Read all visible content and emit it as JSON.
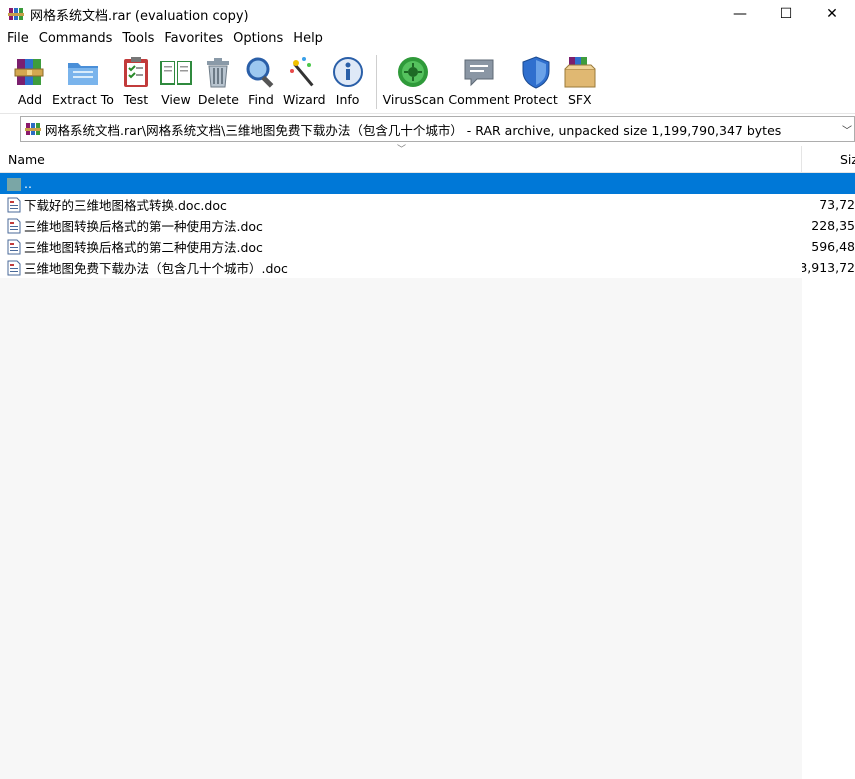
{
  "window": {
    "title": "网格系统文档.rar (evaluation copy)",
    "minimize": "—",
    "maximize": "☐",
    "close": "✕"
  },
  "menu": [
    "File",
    "Commands",
    "Tools",
    "Favorites",
    "Options",
    "Help"
  ],
  "toolbar": [
    {
      "label": "Add",
      "icon": "add-archive-icon"
    },
    {
      "label": "Extract To",
      "icon": "extract-folder-icon"
    },
    {
      "label": "Test",
      "icon": "test-clipboard-icon"
    },
    {
      "label": "View",
      "icon": "view-book-icon"
    },
    {
      "label": "Delete",
      "icon": "trash-can-icon"
    },
    {
      "label": "Find",
      "icon": "magnifier-icon"
    },
    {
      "label": "Wizard",
      "icon": "magic-wand-icon"
    },
    {
      "label": "Info",
      "icon": "info-icon"
    },
    {
      "label": "VirusScan",
      "icon": "virus-scan-icon"
    },
    {
      "label": "Comment",
      "icon": "comment-icon"
    },
    {
      "label": "Protect",
      "icon": "shield-icon"
    },
    {
      "label": "SFX",
      "icon": "sfx-box-icon"
    }
  ],
  "address": {
    "path": "网格系统文档.rar\\网格系统文档\\三维地图免费下载办法（包含几十个城市）  - RAR archive, unpacked size 1,199,790,347 bytes"
  },
  "columns": {
    "name": "Name",
    "size": "Size"
  },
  "files": [
    {
      "name": "..",
      "size": "",
      "selected": true,
      "type": "folder-up"
    },
    {
      "name": "下载好的三维地图格式转换.doc.doc",
      "size": "73,72"
    },
    {
      "name": "三维地图转换后格式的第一种使用方法.doc",
      "size": "228,35"
    },
    {
      "name": "三维地图转换后格式的第二种使用方法.doc",
      "size": "596,48"
    },
    {
      "name": "三维地图免费下载办法（包含几十个城市）.doc",
      "size": "3,913,72"
    }
  ],
  "colors": {
    "selection": "#0078d7"
  }
}
